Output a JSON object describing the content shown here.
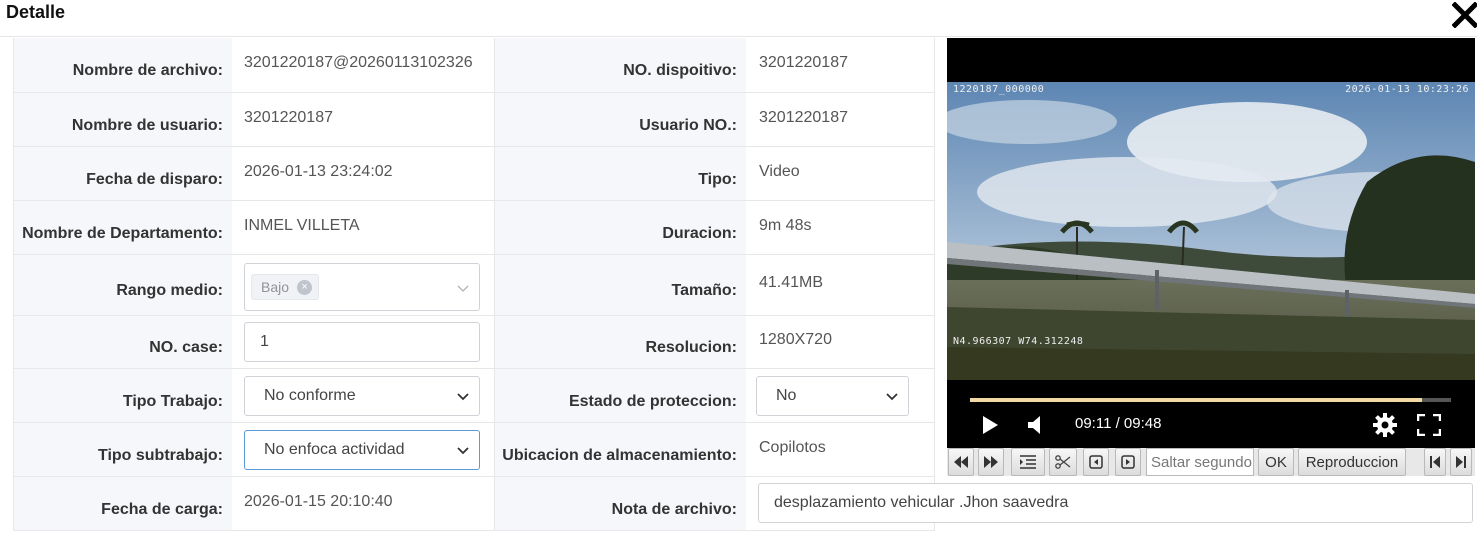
{
  "dialog": {
    "title": "Detalle"
  },
  "form": {
    "rows": [
      {
        "label1": "Nombre de archivo:",
        "value1": "3201220187@20260113102326",
        "label2": "NO. dispoitivo:",
        "value2": "3201220187"
      },
      {
        "label1": "Nombre de usuario:",
        "value1": "3201220187",
        "label2": "Usuario NO.:",
        "value2": "3201220187"
      },
      {
        "label1": "Fecha de disparo:",
        "value1": "2026-01-13 23:24:02",
        "label2": "Tipo:",
        "value2": "Video"
      },
      {
        "label1": "Nombre de Departamento:",
        "value1": "INMEL VILLETA",
        "label2": "Duracion:",
        "value2": "9m 48s"
      },
      {
        "label1": "Rango medio:",
        "tag": "Bajo",
        "label2": "Tamaño:",
        "value2": "41.41MB"
      },
      {
        "label1": "NO. case:",
        "input_value": "1",
        "label2": "Resolucion:",
        "value2": "1280X720"
      },
      {
        "label1": "Tipo Trabajo:",
        "select_value": "No conforme",
        "label2": "Estado de proteccion:",
        "select2_value": "No"
      },
      {
        "label1": "Tipo subtrabajo:",
        "select_value": "No enfoca actividad",
        "label2": "Ubicacion de almacenamiento:",
        "value2": "Copilotos"
      },
      {
        "label1": "Fecha de carga:",
        "value1": "2026-01-15 20:10:40",
        "label2": "Nota de archivo:",
        "note": "desplazamiento vehicular .Jhon saavedra"
      }
    ]
  },
  "video": {
    "osd_top_left": "1220187_000000",
    "osd_top_right": "2026-01-13 10:23:26",
    "osd_bottom_left": "N4.966307 W74.312248",
    "progress": 0.9387,
    "time": "09:11 / 09:48"
  },
  "toolbar": {
    "seek_placeholder": "Saltar segundo",
    "ok_label": "OK",
    "playback_label": "Reproduccion"
  },
  "colors": {
    "accent_focus": "#5b9bd5",
    "label_bg": "#f5f7fa",
    "progress": "#f0d9a4"
  }
}
